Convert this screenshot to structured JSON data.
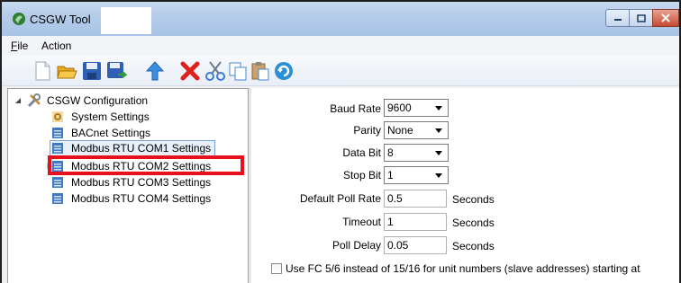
{
  "window": {
    "title": "CSGW Tool"
  },
  "menu": {
    "items": [
      {
        "mnemonic": "F",
        "rest": "ile"
      },
      {
        "mnemonic": "",
        "rest": "Action"
      }
    ]
  },
  "toolbar": {
    "icons": [
      "new-file-icon",
      "open-folder-icon",
      "save-icon",
      "save-as-icon",
      "upload-arrow-icon",
      "delete-icon",
      "cut-icon",
      "copy-icon",
      "paste-icon",
      "refresh-icon"
    ]
  },
  "tree": {
    "root": "CSGW Configuration",
    "items": [
      {
        "label": "System Settings",
        "icon": "gear-settings-icon"
      },
      {
        "label": "BACnet Settings",
        "icon": "document-icon"
      },
      {
        "label": "Modbus RTU COM1 Settings",
        "icon": "document-icon"
      },
      {
        "label": "Modbus RTU COM2 Settings",
        "icon": "document-icon"
      },
      {
        "label": "Modbus RTU COM3 Settings",
        "icon": "document-icon"
      },
      {
        "label": "Modbus RTU COM4 Settings",
        "icon": "document-icon"
      }
    ]
  },
  "form": {
    "baud_rate": {
      "label": "Baud Rate",
      "value": "9600"
    },
    "parity": {
      "label": "Parity",
      "value": "None"
    },
    "data_bit": {
      "label": "Data Bit",
      "value": "8"
    },
    "stop_bit": {
      "label": "Stop Bit",
      "value": "1"
    },
    "default_poll_rate": {
      "label": "Default Poll Rate",
      "value": "0.5",
      "unit": "Seconds"
    },
    "timeout": {
      "label": "Timeout",
      "value": "1",
      "unit": "Seconds"
    },
    "poll_delay": {
      "label": "Poll Delay",
      "value": "0.05",
      "unit": "Seconds"
    },
    "fc_checkbox": {
      "label": "Use FC 5/6 instead of 15/16 for unit numbers (slave addresses) starting at",
      "checked": false
    }
  },
  "colors": {
    "highlight": "#e8101c",
    "selection_border": "#7da2ce"
  }
}
